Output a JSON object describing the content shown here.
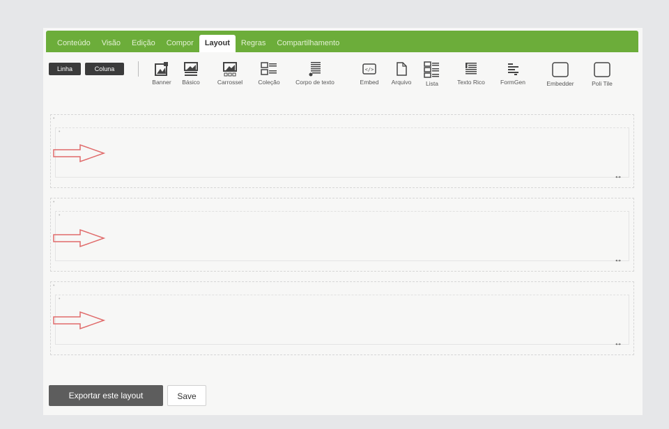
{
  "tabs": [
    {
      "label": "Conteúdo",
      "active": false
    },
    {
      "label": "Visão",
      "active": false
    },
    {
      "label": "Edição",
      "active": false
    },
    {
      "label": "Compor",
      "active": false
    },
    {
      "label": "Layout",
      "active": true
    },
    {
      "label": "Regras",
      "active": false
    },
    {
      "label": "Compartilhamento",
      "active": false
    }
  ],
  "layout_buttons": {
    "row": "Linha",
    "column": "Coluna"
  },
  "tools": [
    {
      "label": "Banner",
      "icon": "banner-icon"
    },
    {
      "label": "Básico",
      "icon": "basic-icon"
    },
    {
      "label": "Carrossel",
      "icon": "carousel-icon"
    },
    {
      "label": "Coleção",
      "icon": "collection-icon"
    },
    {
      "label": "Corpo de texto",
      "icon": "text-body-icon"
    },
    {
      "label": "Embed",
      "icon": "embed-icon"
    },
    {
      "label": "Arquivo",
      "icon": "file-icon"
    },
    {
      "label": "Lista",
      "icon": "list-icon"
    },
    {
      "label": "Texto Rico",
      "icon": "rich-text-icon"
    },
    {
      "label": "FormGen",
      "icon": "formgen-icon"
    },
    {
      "label": "Embedder",
      "icon": "embedder-icon"
    },
    {
      "label": "Poli Tile",
      "icon": "poli-tile-icon"
    }
  ],
  "rows": [
    {
      "resize_glyph": "↔"
    },
    {
      "resize_glyph": "↔"
    },
    {
      "resize_glyph": "↔"
    }
  ],
  "footer": {
    "export_label": "Exportar este layout",
    "save_label": "Save"
  },
  "colors": {
    "tab_bar": "#6cad3a",
    "dark_button": "#3b3b3b",
    "arrow": "#e06a6a"
  }
}
